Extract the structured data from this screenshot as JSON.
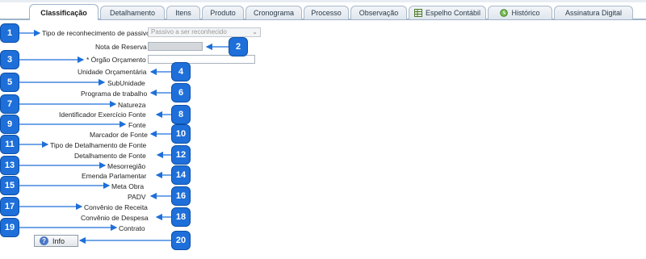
{
  "tabs": [
    {
      "label": "Classificação",
      "active": true
    },
    {
      "label": "Detalhamento"
    },
    {
      "label": "Itens"
    },
    {
      "label": "Produto"
    },
    {
      "label": "Cronograma"
    },
    {
      "label": "Processo"
    },
    {
      "label": "Observação"
    },
    {
      "label": "Espelho Contábil",
      "icon": "spreadsheet-icon"
    },
    {
      "label": "Histórico",
      "icon": "history-icon"
    },
    {
      "label": "Assinatura Digital"
    }
  ],
  "form": {
    "tipo_reconhecimento_label": "Tipo de reconhecimento de passivo",
    "tipo_reconhecimento_value": "Passivo a ser reconhecido",
    "nota_reserva_label": "Nota de Reserva",
    "orgao_orcamento_label": "* Órgão Orçamento",
    "unidade_orcamentaria_label": "Unidade Orçamentária",
    "subunidade_label": "SubUnidade",
    "programa_trabalho_label": "Programa de trabalho",
    "natureza_label": "Natureza",
    "identificador_exercicio_label": "Identificador Exercício Fonte",
    "fonte_label": "Fonte",
    "marcador_fonte_label": "Marcador de Fonte",
    "tipo_detalhamento_label": "Tipo de Detalhamento de Fonte",
    "detalhamento_fonte_label": "Detalhamento de Fonte",
    "mesorregiao_label": "Mesorregião",
    "emenda_parlamentar_label": "Emenda Parlamentar",
    "meta_obra_label": "Meta Obra",
    "padv_label": "PADV",
    "convenio_receita_label": "Convênio de Receita",
    "convenio_despesa_label": "Convênio de Despesa",
    "contrato_label": "Contrato",
    "info_button_label": "Info"
  },
  "badges": [
    "1",
    "2",
    "3",
    "4",
    "5",
    "6",
    "7",
    "8",
    "9",
    "10",
    "11",
    "12",
    "13",
    "14",
    "15",
    "16",
    "17",
    "18",
    "19",
    "20"
  ],
  "colors": {
    "badge": "#1e6fd9",
    "arrow": "#1e6fd9"
  }
}
